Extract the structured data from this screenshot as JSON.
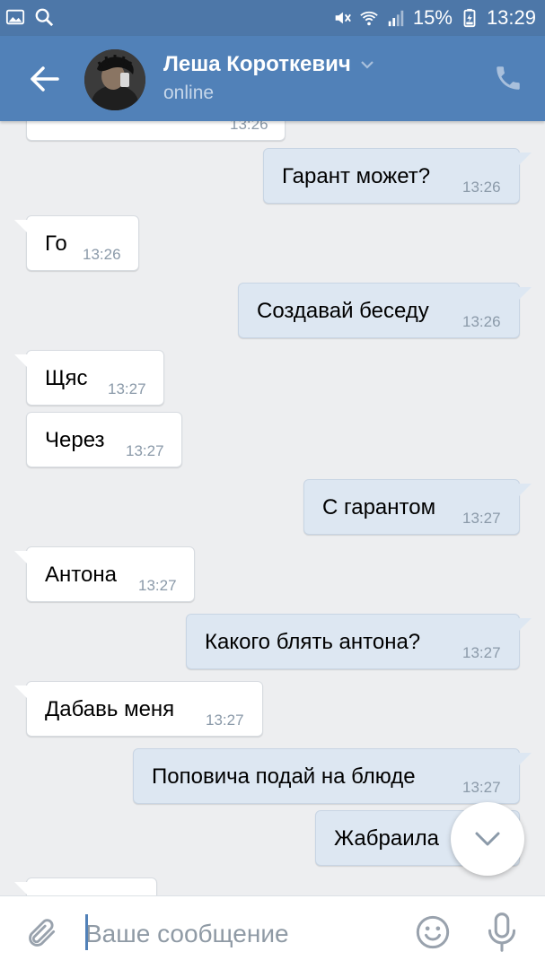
{
  "status_bar": {
    "battery": "15%",
    "time": "13:29",
    "icons": [
      "gallery-icon",
      "search-icon",
      "mute-icon",
      "wifi-icon",
      "signal-icon",
      "battery-icon"
    ]
  },
  "header": {
    "contact_name": "Леша Короткевич",
    "status": "online",
    "colors": {
      "header_bg": "#5181b8",
      "status_bar_bg": "#4d77a8"
    }
  },
  "messages": [
    {
      "dir": "in",
      "text": "",
      "time": "13:26"
    },
    {
      "dir": "out",
      "text": "Гарант может?",
      "time": "13:26"
    },
    {
      "dir": "in",
      "text": "Го",
      "time": "13:26"
    },
    {
      "dir": "out",
      "text": "Создавай беседу",
      "time": "13:26"
    },
    {
      "dir": "in",
      "text": "Щяс",
      "time": "13:27"
    },
    {
      "dir": "in",
      "text": "Через",
      "time": "13:27"
    },
    {
      "dir": "out",
      "text": "С гарантом",
      "time": "13:27"
    },
    {
      "dir": "in",
      "text": "Антона",
      "time": "13:27"
    },
    {
      "dir": "out",
      "text": "Какого блять антона?",
      "time": "13:27"
    },
    {
      "dir": "in",
      "text": "Дабавь меня",
      "time": "13:27"
    },
    {
      "dir": "out",
      "text": "Поповича подай на блюде",
      "time": "13:27"
    },
    {
      "dir": "out",
      "text": "Жабраила",
      "time": ""
    },
    {
      "dir": "in",
      "text": "",
      "time": ""
    }
  ],
  "composer": {
    "placeholder": "Ваше сообщение"
  },
  "colors": {
    "background": "#edeef0",
    "incoming_bubble": "#ffffff",
    "outgoing_bubble": "#dde7f2",
    "accent": "#5181b8"
  }
}
